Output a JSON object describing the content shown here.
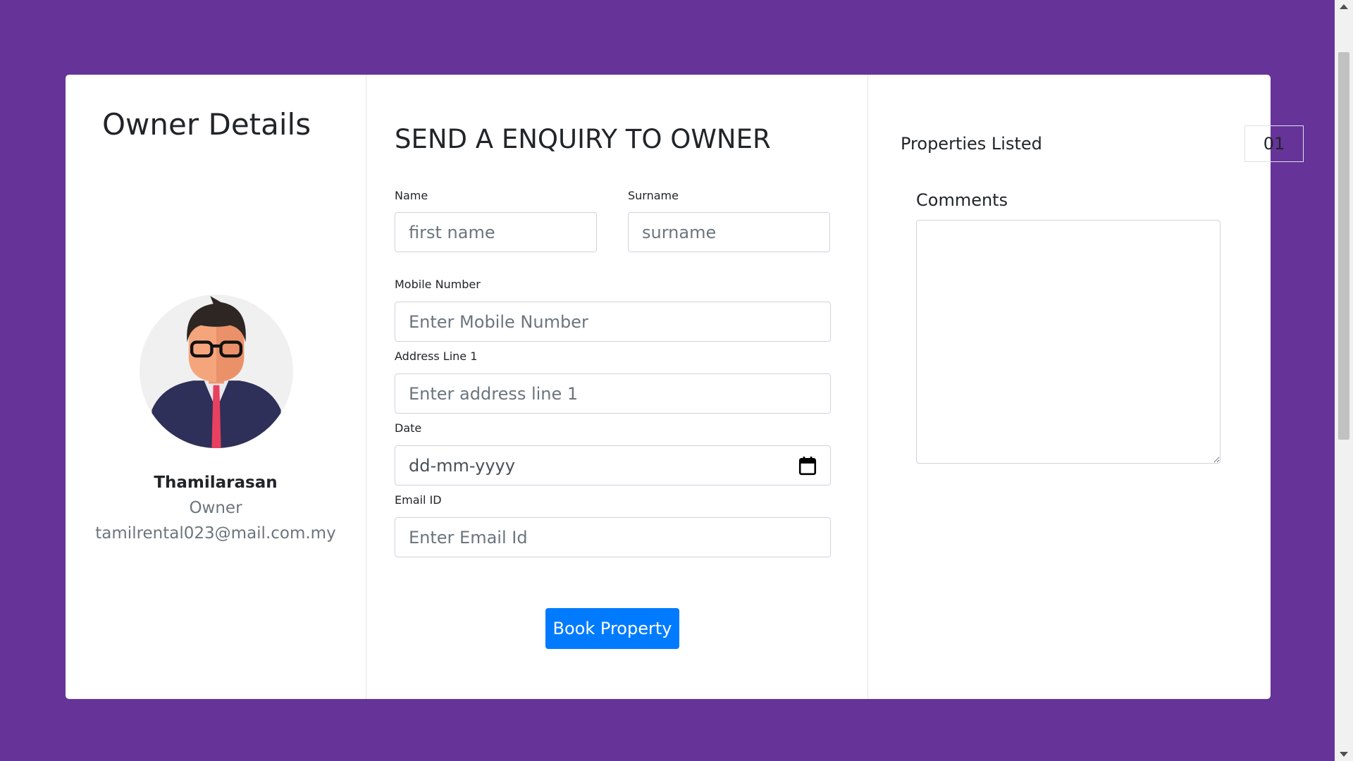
{
  "owner": {
    "title": "Owner Details",
    "name": "Thamilarasan",
    "role": "Owner",
    "email": "tamilrental023@mail.com.my",
    "avatar_icon": "businessman-avatar-icon"
  },
  "enquiry": {
    "title": "SEND A ENQUIRY TO OWNER",
    "name_label": "Name",
    "name_placeholder": "first name",
    "surname_label": "Surname",
    "surname_placeholder": "surname",
    "mobile_label": "Mobile Number",
    "mobile_placeholder": "Enter Mobile Number",
    "address_label": "Address Line 1",
    "address_placeholder": "Enter address line 1",
    "date_label": "Date",
    "date_placeholder": "dd-mm-yyyy",
    "email_label": "Email ID",
    "email_placeholder": "Enter Email Id",
    "submit_label": "Book Property"
  },
  "sidebar": {
    "properties_label": "Properties Listed",
    "properties_count": "01",
    "comments_label": "Comments"
  },
  "colors": {
    "background": "#663399",
    "card": "#ffffff",
    "primary_button": "#007bff"
  }
}
